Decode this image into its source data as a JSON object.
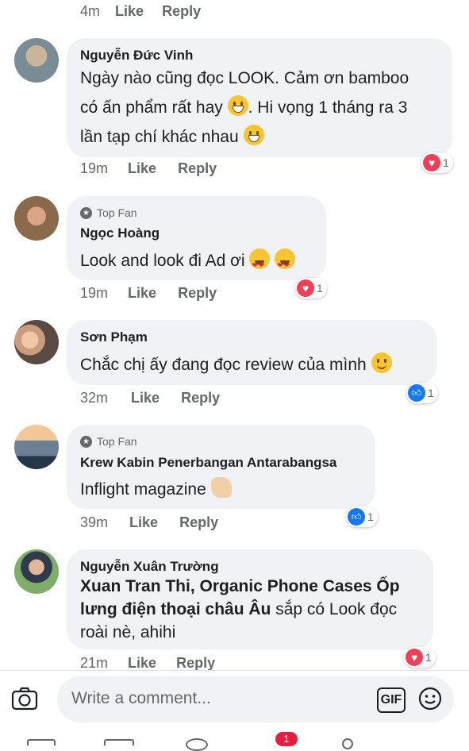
{
  "top_meta": {
    "time": "4m",
    "like": "Like",
    "reply": "Reply"
  },
  "comments": [
    {
      "name": "Nguyễn Đức Vinh",
      "lines": [
        "Ngày nào cũng đọc LOOK. Cảm ơn bamboo",
        "có ấn phẩm rất hay",
        ". Hi vọng 1 tháng ra 3",
        "lần tạp chí khác nhau"
      ],
      "time": "19m",
      "like": "Like",
      "reply": "Reply",
      "reaction": {
        "type": "heart",
        "count": "1"
      }
    },
    {
      "badge": "Top Fan",
      "name": "Ngọc Hoàng",
      "text": "Look and look đi Ad ơi",
      "time": "19m",
      "like": "Like",
      "reply": "Reply",
      "reaction": {
        "type": "heart",
        "count": "1"
      }
    },
    {
      "name": "Sơn Phạm",
      "text": "Chắc chị ấy đang đọc review của mình",
      "time": "32m",
      "like": "Like",
      "reply": "Reply",
      "reaction": {
        "type": "like",
        "count": "1"
      }
    },
    {
      "badge": "Top Fan",
      "name": "Krew Kabin Penerbangan Antarabangsa",
      "text": "Inflight magazine",
      "time": "39m",
      "like": "Like",
      "reply": "Reply",
      "reaction": {
        "type": "like",
        "count": "1"
      }
    },
    {
      "name": "Nguyễn Xuân Trường",
      "mention_lines": [
        "Xuan Tran Thi, Organic Phone Cases Ốp",
        "lưng điện thoại châu Âu"
      ],
      "rest_line1": " sắp có Look đọc",
      "rest_line2": "roài nè, ahihi",
      "time": "21m",
      "like": "Like",
      "reply": "Reply",
      "reaction": {
        "type": "heart",
        "count": "1"
      }
    }
  ],
  "composer": {
    "placeholder": "Write a comment...",
    "gif_label": "GIF"
  },
  "bottom_bar": {
    "notification_count": "1"
  },
  "colors": {
    "bubble": "#f0f2f5",
    "heart": "#f33e58",
    "like": "#1877f2",
    "meta": "#65676b"
  }
}
